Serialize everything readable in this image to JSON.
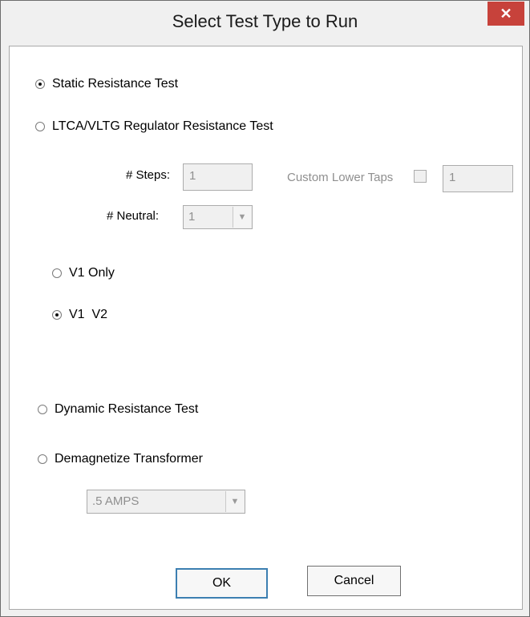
{
  "window": {
    "title": "Select Test Type to Run",
    "close_glyph": "✕"
  },
  "tests": {
    "static": {
      "label": "Static Resistance Test",
      "checked": true
    },
    "ltca": {
      "label": "LTCA/VLTG Regulator Resistance Test",
      "checked": false
    },
    "dynamic": {
      "label": "Dynamic Resistance Test",
      "checked": false
    },
    "demag": {
      "label": "Demagnetize Transformer",
      "checked": false
    }
  },
  "ltca_options": {
    "steps_label": "# Steps:",
    "steps_value": "1",
    "neutral_label": "# Neutral:",
    "neutral_value": "1",
    "custom_lower_taps_label": "Custom Lower Taps",
    "custom_lower_taps_checked": false,
    "custom_lower_taps_value": "1"
  },
  "voltage_mode": {
    "v1_only": {
      "label": "V1 Only",
      "checked": false
    },
    "v1_v2": {
      "label": "V1  V2",
      "checked": true
    }
  },
  "demag_current": {
    "selected": ".5 AMPS"
  },
  "buttons": {
    "ok": "OK",
    "cancel": "Cancel"
  },
  "icons": {
    "close": "close-icon",
    "dropdown": "chevron-down-icon"
  },
  "colors": {
    "close_button": "#c7423b",
    "default_button_border": "#3c7fb1"
  }
}
